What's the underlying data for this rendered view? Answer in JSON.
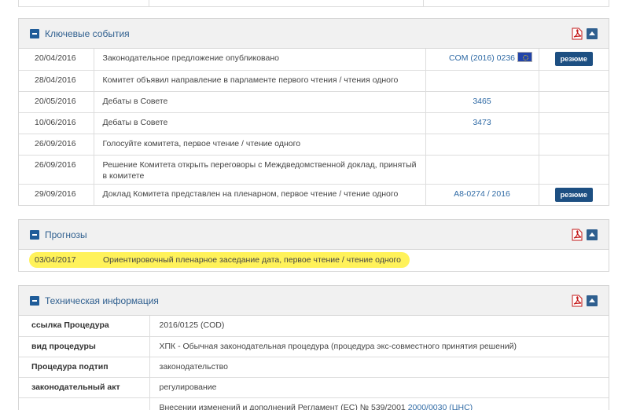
{
  "key_events": {
    "title": "Ключевые события",
    "rows": [
      {
        "date": "20/04/2016",
        "event": "Законодательное предложение опубликовано",
        "ref": "COM (2016) 0236",
        "flag": true,
        "summary": "резюме"
      },
      {
        "date": "28/04/2016",
        "event": "Комитет объявил направление в парламенте первого чтения / чтения одного",
        "ref": "",
        "flag": false,
        "summary": ""
      },
      {
        "date": "20/05/2016",
        "event": "Дебаты в Совете",
        "ref": "3465",
        "flag": false,
        "summary": ""
      },
      {
        "date": "10/06/2016",
        "event": "Дебаты в Совете",
        "ref": "3473",
        "flag": false,
        "summary": ""
      },
      {
        "date": "26/09/2016",
        "event": "Голосуйте комитета, первое чтение / чтение одного",
        "ref": "",
        "flag": false,
        "summary": ""
      },
      {
        "date": "26/09/2016",
        "event": "Решение Комитета открыть переговоры с Междведомственной доклад, принятый в комитете",
        "ref": "",
        "flag": false,
        "summary": ""
      },
      {
        "date": "29/09/2016",
        "event": "Доклад Комитета представлен на пленарном, первое чтение / чтение одного",
        "ref": "A8-0274 / 2016",
        "flag": false,
        "summary": "резюме"
      }
    ]
  },
  "forecasts": {
    "title": "Прогнозы",
    "date": "03/04/2017",
    "text": "Ориентировочный пленарное заседание дата, первое чтение / чтение одного"
  },
  "technical_info": {
    "title": "Техническая информация",
    "rows": [
      {
        "key": "ссылка Процедура",
        "value": "2016/0125 (COD)"
      },
      {
        "key": "вид процедуры",
        "value": "ХПК - Обычная законодательная процедура (процедура экс-совместного принятия решений)"
      },
      {
        "key": "Процедура подтип",
        "value": "законодательство"
      },
      {
        "key": "законодательный акт",
        "value": "регулирование"
      },
      {
        "key": "",
        "value": "Внесении изменений и дополнений Регламент (ЕС) № 539/2001",
        "link": "2000/0030",
        "suffix": "(ЦНС)"
      }
    ]
  },
  "icons": {
    "collapse": "minus-icon",
    "pdf": "pdf-icon",
    "up": "arrow-up-icon",
    "flag": "eu-flag-icon"
  },
  "colors": {
    "title": "#2f5f8f",
    "link": "#2f6aa5",
    "button": "#1d4f82",
    "highlight": "#fff25a"
  }
}
